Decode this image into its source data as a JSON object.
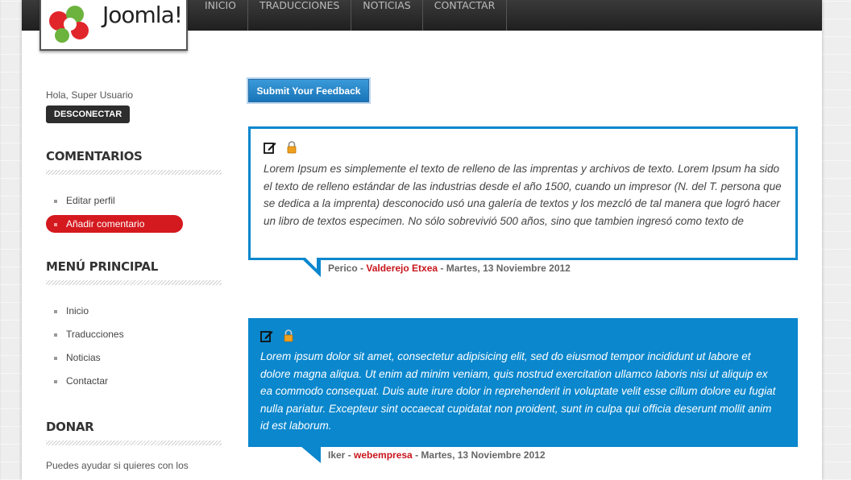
{
  "header": {
    "logo_text": "Joomla!",
    "nav": [
      {
        "label": "INICIO"
      },
      {
        "label": "TRADUCCIONES"
      },
      {
        "label": "NOTICIAS"
      },
      {
        "label": "CONTACTAR"
      }
    ]
  },
  "sidebar": {
    "greeting": "Hola, Super Usuario",
    "logout_label": "DESCONECTAR",
    "comments_title": "COMENTARIOS",
    "comments_menu": [
      {
        "label": "Editar perfil",
        "active": false
      },
      {
        "label": "Añadir comentario",
        "active": true
      }
    ],
    "main_menu_title": "MENÚ PRINCIPAL",
    "main_menu": [
      {
        "label": "Inicio"
      },
      {
        "label": "Traducciones"
      },
      {
        "label": "Noticias"
      },
      {
        "label": "Contactar"
      }
    ],
    "donate_title": "DONAR",
    "donate_text": "Puedes ayudar si quieres con los"
  },
  "main": {
    "feedback_button": "Submit Your Feedback",
    "comments": [
      {
        "text": "Lorem Ipsum es simplemente el texto de relleno de las imprentas y archivos de texto. Lorem Ipsum ha sido el texto de relleno estándar de las industrias desde el año 1500, cuando un impresor (N. del T. persona que se dedica a la imprenta) desconocido usó una galería de textos y los mezcló de tal manera que logró hacer un libro de textos especimen. No sólo sobrevivió 500 años, sino que tambien ingresó como texto de",
        "author": "Perico",
        "sep1": " - ",
        "user": "Valderejo Etxea",
        "sep2": " - ",
        "date": "Martes, 13 Noviembre 2012"
      },
      {
        "text": "Lorem ipsum dolor sit amet, consectetur adipisicing elit, sed do eiusmod tempor incididunt ut labore et dolore magna aliqua. Ut enim ad minim veniam, quis nostrud exercitation ullamco laboris nisi ut aliquip ex ea commodo consequat. Duis aute irure dolor in reprehenderit in voluptate velit esse cillum dolore eu fugiat nulla pariatur. Excepteur sint occaecat cupidatat non proident, sunt in culpa qui officia deserunt mollit anim id est laborum.",
        "author": "Iker",
        "sep1": " - ",
        "user": "webempresa",
        "sep2": " - ",
        "date": "Martes, 13 Noviembre 2012"
      }
    ]
  },
  "colors": {
    "accent_blue": "#0a87cd",
    "accent_red": "#d4191f",
    "topbar": "#2a2a2a"
  },
  "icons": {
    "edit": "edit-icon",
    "lock": "lock-icon"
  }
}
